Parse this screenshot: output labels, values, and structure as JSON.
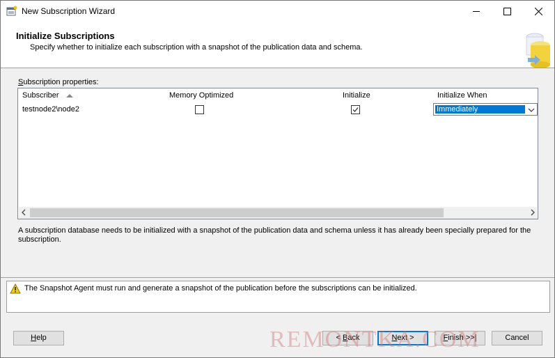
{
  "window": {
    "title": "New Subscription Wizard",
    "controls": {
      "minimize": "minimize-icon",
      "maximize": "maximize-icon",
      "close": "close-icon"
    }
  },
  "header": {
    "title": "Initialize Subscriptions",
    "subtitle": "Specify whether to initialize each subscription with a snapshot of the publication data and schema."
  },
  "properties": {
    "label_prefix": "",
    "label_mnemonic": "S",
    "label_rest": "ubscription properties:"
  },
  "grid": {
    "columns": [
      "Subscriber",
      "Memory Optimized",
      "Initialize",
      "Initialize When"
    ],
    "sort_column": "Subscriber",
    "rows": [
      {
        "subscriber": "testnode2\\node2",
        "memory_optimized": false,
        "initialize": true,
        "initialize_when": "Immediately"
      }
    ]
  },
  "description": "A subscription database needs to be initialized with a snapshot of the publication data and schema unless it has already been specially prepared for the subscription.",
  "message": {
    "icon": "warning-icon",
    "text": "The Snapshot Agent must run and generate a snapshot of the publication before the subscriptions can be initialized."
  },
  "buttons": {
    "help": {
      "m": "H",
      "rest": "elp"
    },
    "back": {
      "pre": "< ",
      "m": "B",
      "rest": "ack"
    },
    "next": {
      "m": "N",
      "rest": "ext >"
    },
    "finish": {
      "m": "F",
      "rest": "inish >>|"
    },
    "cancel": {
      "label": "Cancel"
    }
  },
  "watermark": "REMONTKA.COM",
  "colors": {
    "selection": "#0078d7",
    "warning": "#f5d000"
  }
}
